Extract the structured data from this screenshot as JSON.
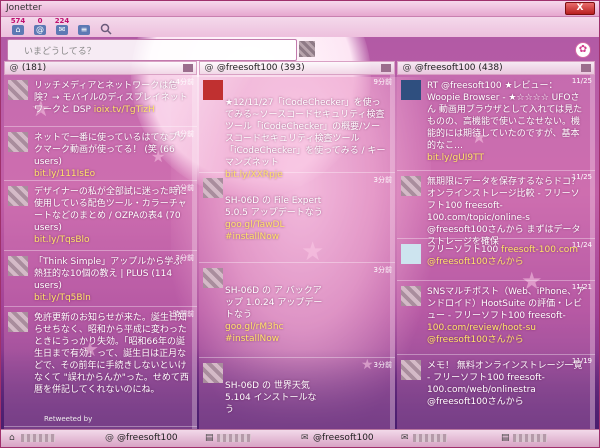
{
  "window": {
    "title": "Jonetter",
    "close_label": "X"
  },
  "toolbar": {
    "items": [
      {
        "name": "home",
        "count": "574",
        "icon": "home-icon"
      },
      {
        "name": "mention",
        "count": "0",
        "icon": "mention-icon"
      },
      {
        "name": "favorite",
        "count": "224",
        "icon": "favorite-icon"
      },
      {
        "name": "message",
        "count": "",
        "icon": "message-icon"
      }
    ]
  },
  "input": {
    "placeholder": "いまどうしてる？"
  },
  "columns": [
    {
      "header_icon": "@",
      "header_count": "(181)",
      "tweets": [
        {
          "time": "4分前",
          "text": "リッチメディアとネットワークは危険？→ モバイルのディスプレイネットワークと DSP ",
          "link": "ioix.tv/TgTizH"
        },
        {
          "time": "4分前",
          "text": "ネットで一番に使っているはてなブックマーク動画が使ってる！ (笑 (66 users)",
          "link": "bit.ly/111IsEo"
        },
        {
          "time": "2分前",
          "text": "デザイナーの私が全部試に迷った時に使用している配色ツール・カラーチャートなどのまとめ / OZPAの表4 (70 users)",
          "link": "bit.ly/TqsBlo"
        },
        {
          "time": "2分前",
          "text": "「Think Simple」アップルから学ぶ熱狂的な10個の教え | PLUS (114 users)",
          "link": "bit.ly/Tq5Bln"
        },
        {
          "time": "1時間前",
          "text": "免許更新のお知らせが来た。誕生日知らせちなく、昭和から平成に変わったときにうっかり失効。「昭和66年の誕生日まで有効」って、誕生日は正月などで、その前年に手続きしないといけなくて \"誤れからんか\"った。せめて西暦を併記してくれないのにね。",
          "link": "",
          "retweet": "Retweeted by"
        }
      ]
    },
    {
      "header_icon": "@",
      "header_count": "@freesoft100 (393)",
      "tweets": [
        {
          "time": "9分前",
          "text": "★12/11/27「iCodeChecker」を使ってみる~ソースコードセキュリティ検査ツール「iCodeChecker」の概要/ソースコードセキュリティ検査ツール「iCodeChecker」を使ってみる / キーマンズネット",
          "link": "bit.ly/XXRpje"
        },
        {
          "time": "3分前",
          "text": "SH-06D の File Expert 5.0.5 アップデートなう",
          "link": "goo.gl/TawDL #installNow"
        },
        {
          "time": "3分前",
          "text": "SH-06D の ア バックアップ 1.0.24 アップデートなう",
          "link": "goo.gl/rM3hc #installNow"
        },
        {
          "time": "3分前",
          "text": "SH-06D の 世界天気 5.104 インストールなう",
          "link": ""
        }
      ]
    },
    {
      "header_icon": "@",
      "header_count": "@freesoft100 (438)",
      "tweets": [
        {
          "time": "11/25",
          "text": "RT @freesoft100 ★レビュー：Woopie Browser - ★☆☆☆☆ UFOさん 動画用ブラウザとして入れては見たものの、高機能で使いこなせない。機能的には期待していたのですが、基本的なこ…",
          "link": "bit.ly/gUI9TT"
        },
        {
          "time": "11/25",
          "text": "無期限にデータを保存するならドコ？オンラインストレージ比較 - フリーソフト100 freesoft-100.com/topic/online-s @freesoft100さんから まずはデータストレージを確保",
          "link": ""
        },
        {
          "time": "11/24",
          "text": "フリーソフト100 ",
          "link": "freesoft-100.com @freesoft100さんから"
        },
        {
          "time": "11/21",
          "text": "SNSマルチポスト（Web、iPhone、アンドロイド）HootSuite の評価・レビュー - フリーソフト100 freesoft-",
          "link": "100.com/review/hoot-su @freesoft100さんから"
        },
        {
          "time": "11/19",
          "text": "メモ！ 無料オンラインストレージ一覧 - フリーソフト100 freesoft-100.com/web/onlinestra @freesoft100さんから",
          "link": ""
        }
      ]
    }
  ],
  "tabs": [
    {
      "label": ""
    },
    {
      "label": "@freesoft100"
    },
    {
      "label": "@freesoft100"
    },
    {
      "label": ""
    },
    {
      "label": ""
    }
  ]
}
